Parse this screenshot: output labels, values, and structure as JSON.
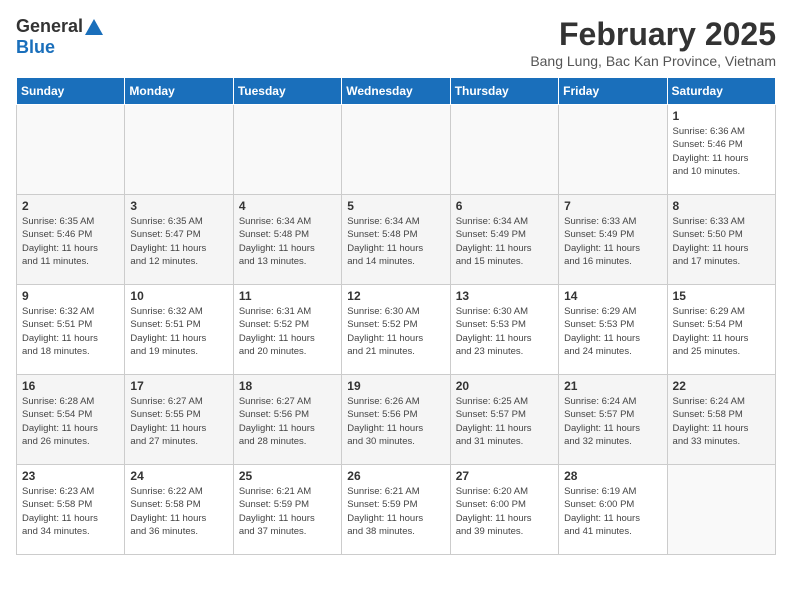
{
  "logo": {
    "general": "General",
    "blue": "Blue"
  },
  "header": {
    "month": "February 2025",
    "location": "Bang Lung, Bac Kan Province, Vietnam"
  },
  "weekdays": [
    "Sunday",
    "Monday",
    "Tuesday",
    "Wednesday",
    "Thursday",
    "Friday",
    "Saturday"
  ],
  "weeks": [
    [
      {
        "day": "",
        "info": ""
      },
      {
        "day": "",
        "info": ""
      },
      {
        "day": "",
        "info": ""
      },
      {
        "day": "",
        "info": ""
      },
      {
        "day": "",
        "info": ""
      },
      {
        "day": "",
        "info": ""
      },
      {
        "day": "1",
        "info": "Sunrise: 6:36 AM\nSunset: 5:46 PM\nDaylight: 11 hours\nand 10 minutes."
      }
    ],
    [
      {
        "day": "2",
        "info": "Sunrise: 6:35 AM\nSunset: 5:46 PM\nDaylight: 11 hours\nand 11 minutes."
      },
      {
        "day": "3",
        "info": "Sunrise: 6:35 AM\nSunset: 5:47 PM\nDaylight: 11 hours\nand 12 minutes."
      },
      {
        "day": "4",
        "info": "Sunrise: 6:34 AM\nSunset: 5:48 PM\nDaylight: 11 hours\nand 13 minutes."
      },
      {
        "day": "5",
        "info": "Sunrise: 6:34 AM\nSunset: 5:48 PM\nDaylight: 11 hours\nand 14 minutes."
      },
      {
        "day": "6",
        "info": "Sunrise: 6:34 AM\nSunset: 5:49 PM\nDaylight: 11 hours\nand 15 minutes."
      },
      {
        "day": "7",
        "info": "Sunrise: 6:33 AM\nSunset: 5:49 PM\nDaylight: 11 hours\nand 16 minutes."
      },
      {
        "day": "8",
        "info": "Sunrise: 6:33 AM\nSunset: 5:50 PM\nDaylight: 11 hours\nand 17 minutes."
      }
    ],
    [
      {
        "day": "9",
        "info": "Sunrise: 6:32 AM\nSunset: 5:51 PM\nDaylight: 11 hours\nand 18 minutes."
      },
      {
        "day": "10",
        "info": "Sunrise: 6:32 AM\nSunset: 5:51 PM\nDaylight: 11 hours\nand 19 minutes."
      },
      {
        "day": "11",
        "info": "Sunrise: 6:31 AM\nSunset: 5:52 PM\nDaylight: 11 hours\nand 20 minutes."
      },
      {
        "day": "12",
        "info": "Sunrise: 6:30 AM\nSunset: 5:52 PM\nDaylight: 11 hours\nand 21 minutes."
      },
      {
        "day": "13",
        "info": "Sunrise: 6:30 AM\nSunset: 5:53 PM\nDaylight: 11 hours\nand 23 minutes."
      },
      {
        "day": "14",
        "info": "Sunrise: 6:29 AM\nSunset: 5:53 PM\nDaylight: 11 hours\nand 24 minutes."
      },
      {
        "day": "15",
        "info": "Sunrise: 6:29 AM\nSunset: 5:54 PM\nDaylight: 11 hours\nand 25 minutes."
      }
    ],
    [
      {
        "day": "16",
        "info": "Sunrise: 6:28 AM\nSunset: 5:54 PM\nDaylight: 11 hours\nand 26 minutes."
      },
      {
        "day": "17",
        "info": "Sunrise: 6:27 AM\nSunset: 5:55 PM\nDaylight: 11 hours\nand 27 minutes."
      },
      {
        "day": "18",
        "info": "Sunrise: 6:27 AM\nSunset: 5:56 PM\nDaylight: 11 hours\nand 28 minutes."
      },
      {
        "day": "19",
        "info": "Sunrise: 6:26 AM\nSunset: 5:56 PM\nDaylight: 11 hours\nand 30 minutes."
      },
      {
        "day": "20",
        "info": "Sunrise: 6:25 AM\nSunset: 5:57 PM\nDaylight: 11 hours\nand 31 minutes."
      },
      {
        "day": "21",
        "info": "Sunrise: 6:24 AM\nSunset: 5:57 PM\nDaylight: 11 hours\nand 32 minutes."
      },
      {
        "day": "22",
        "info": "Sunrise: 6:24 AM\nSunset: 5:58 PM\nDaylight: 11 hours\nand 33 minutes."
      }
    ],
    [
      {
        "day": "23",
        "info": "Sunrise: 6:23 AM\nSunset: 5:58 PM\nDaylight: 11 hours\nand 34 minutes."
      },
      {
        "day": "24",
        "info": "Sunrise: 6:22 AM\nSunset: 5:58 PM\nDaylight: 11 hours\nand 36 minutes."
      },
      {
        "day": "25",
        "info": "Sunrise: 6:21 AM\nSunset: 5:59 PM\nDaylight: 11 hours\nand 37 minutes."
      },
      {
        "day": "26",
        "info": "Sunrise: 6:21 AM\nSunset: 5:59 PM\nDaylight: 11 hours\nand 38 minutes."
      },
      {
        "day": "27",
        "info": "Sunrise: 6:20 AM\nSunset: 6:00 PM\nDaylight: 11 hours\nand 39 minutes."
      },
      {
        "day": "28",
        "info": "Sunrise: 6:19 AM\nSunset: 6:00 PM\nDaylight: 11 hours\nand 41 minutes."
      },
      {
        "day": "",
        "info": ""
      }
    ]
  ]
}
